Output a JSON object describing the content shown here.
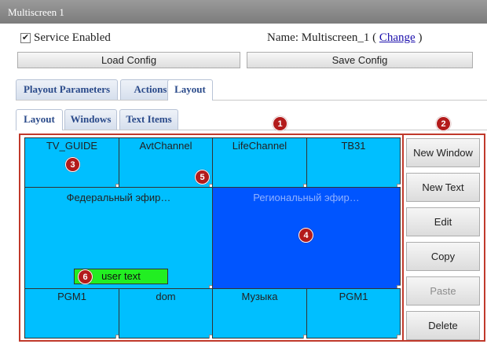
{
  "window": {
    "title": "Multiscreen 1"
  },
  "service": {
    "checked": true,
    "check_glyph": "✔",
    "label": "Service Enabled"
  },
  "name_row": {
    "label": "Name:",
    "value": "Multiscreen_1",
    "open_paren": "(",
    "link": "Change",
    "close_paren": ")"
  },
  "config": {
    "load_label": "Load Config",
    "save_label": "Save Config"
  },
  "main_tabs": [
    {
      "label": "Playout Parameters",
      "active": false
    },
    {
      "label": "Actions",
      "active": false
    },
    {
      "label": "Layout",
      "active": true
    }
  ],
  "sub_tabs": [
    {
      "label": "Layout",
      "active": true
    },
    {
      "label": "Windows",
      "active": false
    },
    {
      "label": "Text Items",
      "active": false
    }
  ],
  "windows": {
    "row1": [
      "TV_GUIDE",
      "AvtChannel",
      "LifeChannel",
      "TB31"
    ],
    "federal": "Федеральный эфир…",
    "regional": "Региональный эфир…",
    "row3": [
      "PGM1",
      "dom",
      "Музыка",
      "PGM1"
    ]
  },
  "text_item": {
    "label": "user text",
    "color": "#22ee22"
  },
  "side_buttons": [
    {
      "label": "New Window",
      "enabled": true
    },
    {
      "label": "New Text",
      "enabled": true
    },
    {
      "label": "Edit",
      "enabled": true
    },
    {
      "label": "Copy",
      "enabled": true
    },
    {
      "label": "Paste",
      "enabled": false
    },
    {
      "label": "Delete",
      "enabled": true
    }
  ],
  "annotations": [
    "1",
    "2",
    "3",
    "4",
    "5",
    "6"
  ],
  "colors": {
    "window_fill": "#00bfff",
    "selected_window_fill": "#0055ff",
    "annotation_frame": "#c0392b",
    "badge": "#b31b1b"
  }
}
